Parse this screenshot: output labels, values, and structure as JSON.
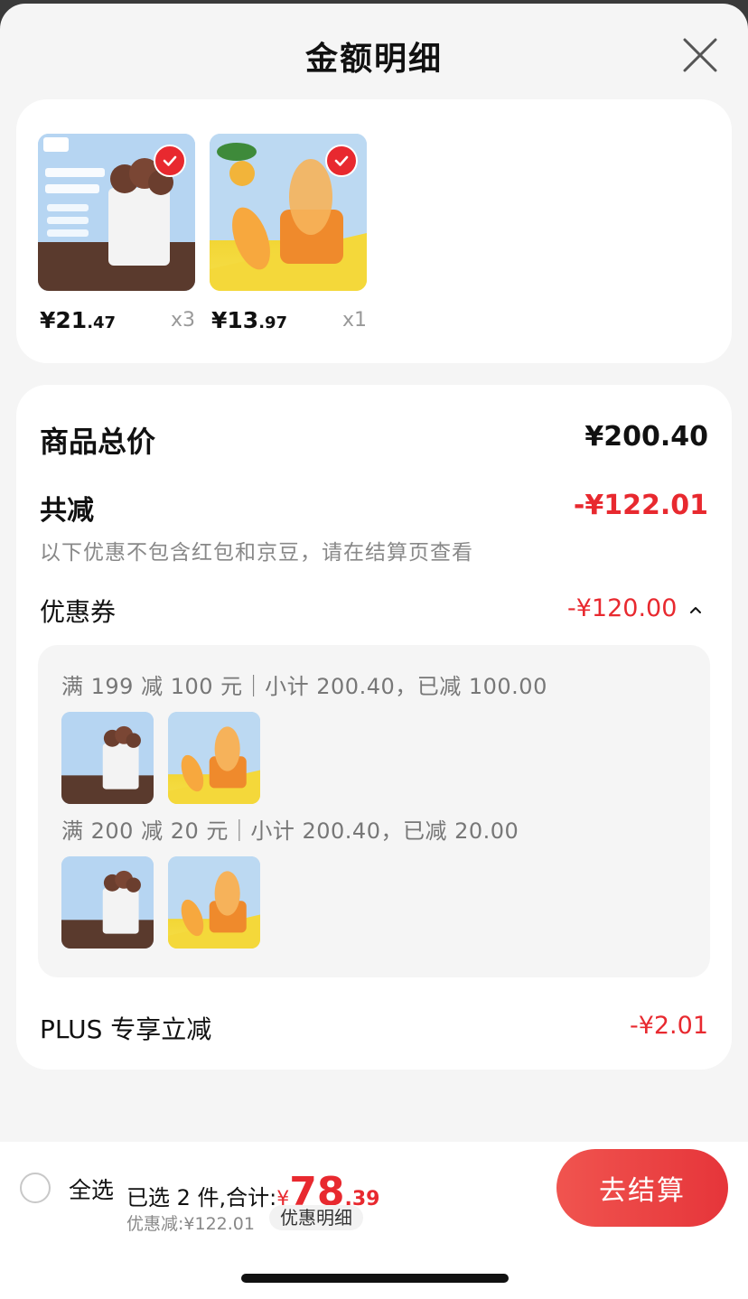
{
  "sheet": {
    "title": "金额明细"
  },
  "products": [
    {
      "price_int": "¥21",
      "price_dec": ".47",
      "qty": "x3",
      "image": "ice-cream-tub"
    },
    {
      "price_int": "¥13",
      "price_dec": ".97",
      "qty": "x1",
      "image": "mango-popsicle"
    }
  ],
  "summary": {
    "total_label": "商品总价",
    "total_value": "¥200.40",
    "reduce_label": "共减",
    "reduce_value": "-¥122.01",
    "note": "以下优惠不包含红包和京豆，请在结算页查看",
    "coupon_label": "优惠券",
    "coupon_value": "-¥120.00",
    "coupon_rules": [
      {
        "text": "满 199 减 100 元｜小计 200.40，已减 100.00"
      },
      {
        "text": "满 200 减 20 元｜小计 200.40，已减 20.00"
      }
    ],
    "plus_label": "PLUS 专享立减",
    "plus_value": "-¥2.01"
  },
  "footer": {
    "select_all": "全选",
    "selected_text": "已选 2 件,合计:",
    "currency": "¥",
    "total_int": "78",
    "total_dec": ".39",
    "discount_text": "优惠减:¥122.01",
    "detail_chip": "优惠明细",
    "checkout": "去结算"
  },
  "colors": {
    "accent": "#e8292f",
    "text": "#111111",
    "muted": "#999999"
  },
  "icons": [
    "close-icon",
    "check-icon",
    "chevron-up-icon"
  ]
}
